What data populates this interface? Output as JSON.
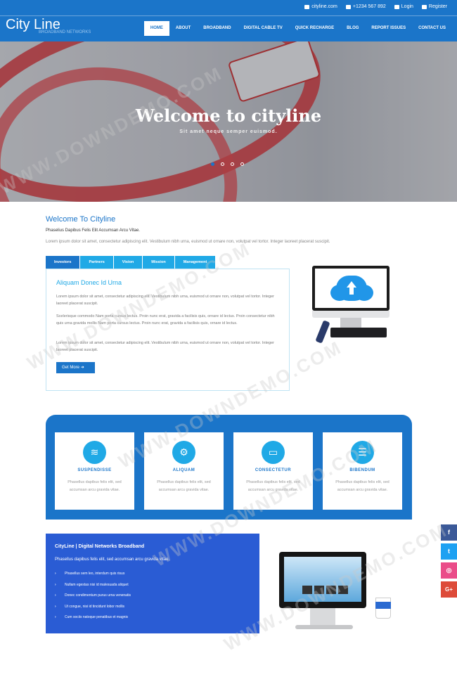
{
  "topbar": {
    "site": "cityline.com",
    "phone": "+1234 567 892",
    "login": "Login",
    "register": "Register"
  },
  "logo": {
    "name": "City Line",
    "tagline": "BROADBAND NETWORKS"
  },
  "nav": [
    "HOME",
    "ABOUT",
    "BROADBAND",
    "DIGITAL CABLE TV",
    "QUICK RECHARGE",
    "BLOG",
    "REPORT ISSUES",
    "CONTACT US"
  ],
  "hero": {
    "title": "Welcome to cityline",
    "subtitle": "Sit amet neque semper euismod."
  },
  "welcome": {
    "title": "Welcome To Cityline",
    "subtitle": "Phaselius Dapibus Felis Elit Accumsan Arcu Vitae.",
    "text": "Lorem ipsum dolor sit amet, consectetur adipiscing elit. Vestibulum nibh urna, euismod ut ornare non, volutpat vel tortor. Integer laoreet placerat suscipit."
  },
  "tabs": {
    "labels": [
      "Investors",
      "Partners",
      "Vision",
      "Mission",
      "Management"
    ],
    "content_title": "Aliquam Donec Id Urna",
    "p1": "Lorem ipsum dolor sit amet, consectetur adipiscing elit. Vestibulum nibh urna, euismod ut ornare non, volutpat vel tortor. Integer laoreet placerat suscipit.",
    "p2": "Scelerisque commodo Nam porta cursus lectus. Proin nunc erat, gravida a facilisis quis, ornare id lectus. Proin consectetur nibh quis urna gravida mollis Nam porta cursus lectus. Proin nunc erat, gravida a facilisis quis, ornare id lectus.",
    "p3": "Lorem ipsum dolor sit amet, consectetur adipiscing elit. Vestibulum nibh urna, euismod ut ornare non, volutpat vel tortor. Integer laoreet placerat suscipit.",
    "button": "Get More"
  },
  "services": [
    {
      "title": "SUSPENDISSE",
      "text": "Phasellus dapibus felis elit, sed accumsan arcu gravida vitae.",
      "icon": "wifi-icon"
    },
    {
      "title": "ALIQUAM",
      "text": "Phasellus dapibus felis elit, sed accumsan arcu gravida vitae.",
      "icon": "gear-icon"
    },
    {
      "title": "CONSECTETUR",
      "text": "Phasellus dapibus felis elit, sed accumsan arcu gravida vitae.",
      "icon": "monitor-icon"
    },
    {
      "title": "BIBENDUM",
      "text": "Phasellus dapibus felis elit, sed accumsan arcu gravida vitae.",
      "icon": "server-icon"
    }
  ],
  "digital": {
    "title": "CityLine | Digital Networks Broadband",
    "subtitle": "Phasellus dapibus felis elit, sed accumsan arcu gravida vitae.",
    "items": [
      "Phasellus sem leo, interdum quis risus",
      "Nullam egestas nisi id malesuada aliquet",
      "Donec condimentum purus urna venenatis",
      "Ut congue, nisi id tincidunt lobor mollis",
      "Cum sociis natoque penatibus et magnis"
    ]
  },
  "social": [
    {
      "name": "facebook-icon",
      "glyph": "f",
      "color": "#3b5998"
    },
    {
      "name": "twitter-icon",
      "glyph": "t",
      "color": "#1da1f2"
    },
    {
      "name": "dribbble-icon",
      "glyph": "◎",
      "color": "#ea4c89"
    },
    {
      "name": "google-plus-icon",
      "glyph": "G+",
      "color": "#dd4b39"
    }
  ],
  "watermark": "WWW.DOWNDEMO.COM",
  "colors": {
    "primary": "#1b75c9",
    "accent": "#20a9e6",
    "dark_blue": "#2a5cd4"
  }
}
